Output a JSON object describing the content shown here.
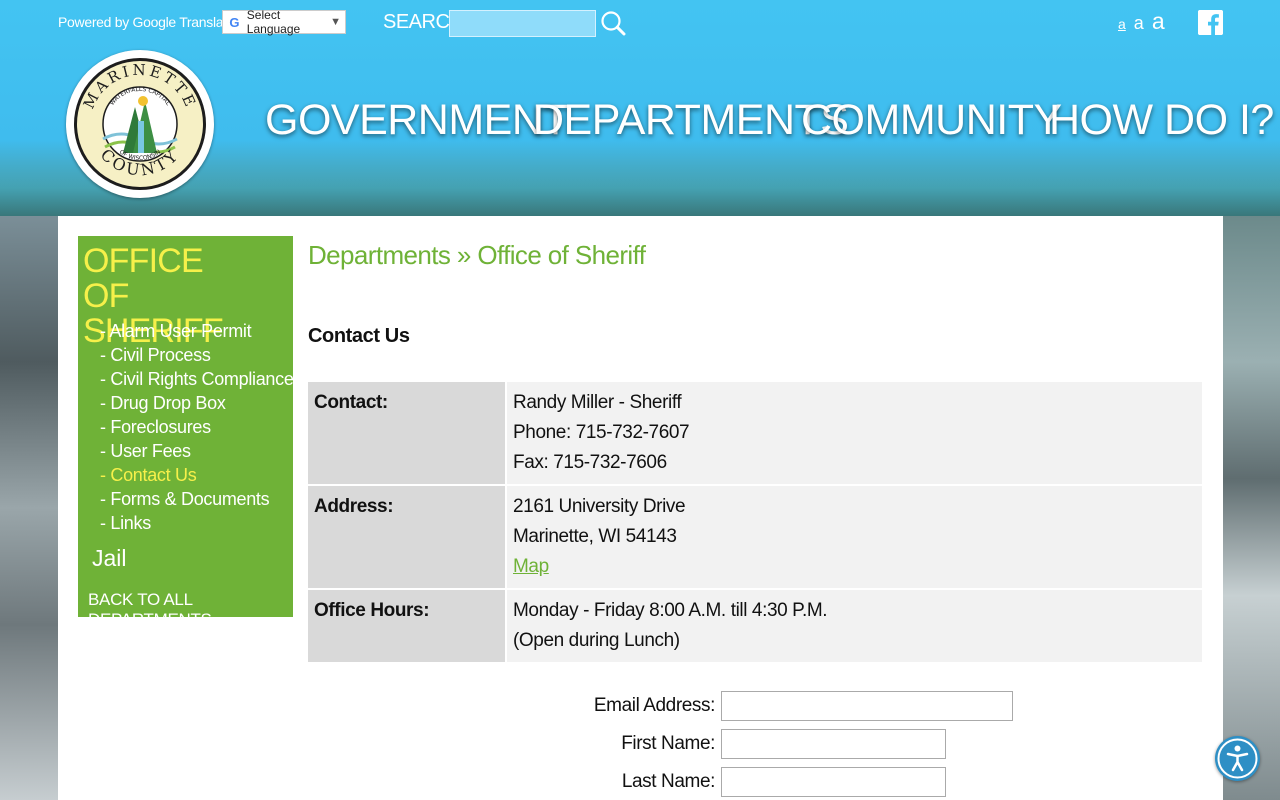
{
  "topbar": {
    "translate_label": "Powered by Google Translate",
    "translate_g": "G",
    "language_select": "Select Language",
    "search_label": "SEARCH",
    "search_value": "",
    "font_small": "a",
    "font_medium": "a",
    "font_large": "a"
  },
  "nav": {
    "government": "GOVERNMENT",
    "departments": "DEPARTMENTS",
    "community": "COMMUNITY",
    "howdoi": "HOW DO I?"
  },
  "logo": {
    "top_text": "MARINETTE",
    "ring_text": "WATERFALLS CAPITAL",
    "ring_text_bottom": "OF WISCONSIN",
    "bottom_text": "COUNTY"
  },
  "sidebar": {
    "title": "OFFICE OF SHERIFF",
    "items": [
      {
        "label": "- Alarm User Permit"
      },
      {
        "label": "- Civil Process"
      },
      {
        "label": "- Civil Rights Compliance"
      },
      {
        "label": "- Drug Drop Box"
      },
      {
        "label": "- Foreclosures"
      },
      {
        "label": "- User Fees"
      },
      {
        "label": "- Contact Us"
      },
      {
        "label": "- Forms & Documents"
      },
      {
        "label": "- Links"
      }
    ],
    "jail": "Jail",
    "back": "BACK TO ALL DEPARTMENTS"
  },
  "main": {
    "breadcrumb": "Departments » Office of Sheriff",
    "section_title": "Contact Us",
    "contact_label": "Contact:",
    "contact_lines": [
      "Randy Miller - Sheriff",
      "Phone: 715-732-7607",
      "Fax: 715-732-7606"
    ],
    "address_label": "Address:",
    "address_lines": [
      "2161 University Drive",
      "Marinette, WI 54143"
    ],
    "map_link": "Map",
    "hours_label": "Office Hours:",
    "hours_lines": [
      "Monday - Friday 8:00 A.M. till 4:30 P.M.",
      "(Open during Lunch)"
    ]
  },
  "form": {
    "email_label": "Email Address:",
    "first_label": "First Name:",
    "last_label": "Last Name:"
  },
  "colors": {
    "sky": "#43c4f2",
    "green": "#6fb237",
    "yellow": "#f6f04a",
    "accessibility": "#2e8fc5"
  }
}
